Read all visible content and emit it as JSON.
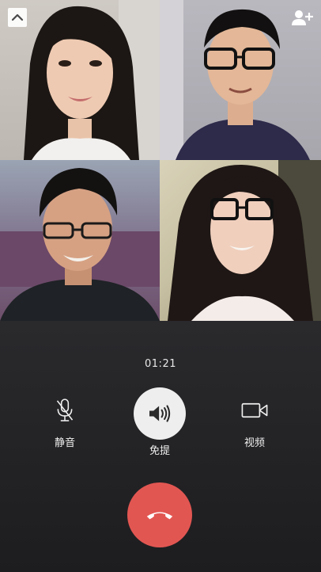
{
  "call": {
    "timer": "01:21"
  },
  "participants": [
    {
      "id": "participant-1"
    },
    {
      "id": "participant-2"
    },
    {
      "id": "participant-3"
    },
    {
      "id": "participant-4"
    }
  ],
  "controls": {
    "mute_label": "静音",
    "speaker_label": "免提",
    "video_label": "视频"
  },
  "icons": {
    "collapse": "chevron-up-icon",
    "add_user": "add-user-icon",
    "mute": "microphone-muted-icon",
    "speaker": "speaker-icon",
    "video": "video-camera-icon",
    "hangup": "hang-up-icon"
  },
  "colors": {
    "panel_bg": "#1f1f21",
    "speaker_active_bg": "#eeeeee",
    "hangup_red": "#e25652",
    "text": "#f0f0f0"
  }
}
